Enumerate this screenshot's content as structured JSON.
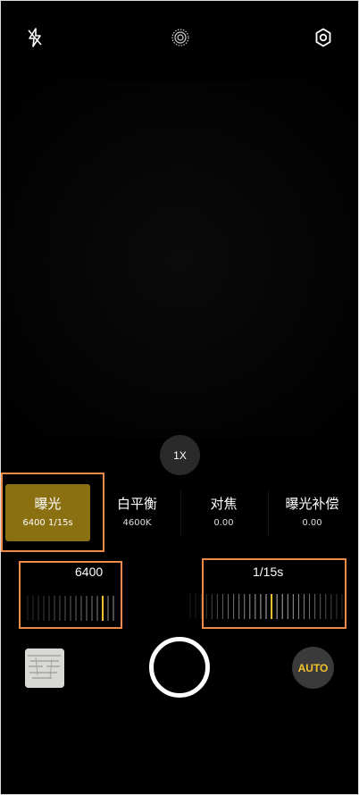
{
  "zoom": {
    "label": "1X"
  },
  "modes": [
    {
      "name": "曝光",
      "value": "6400 1/15s",
      "selected": true
    },
    {
      "name": "白平衡",
      "value": "4600K",
      "selected": false
    },
    {
      "name": "对焦",
      "value": "0.00",
      "selected": false
    },
    {
      "name": "曝光补偿",
      "value": "0.00",
      "selected": false
    }
  ],
  "iso_dial": {
    "value": "6400"
  },
  "shutter_dial": {
    "value": "1/15s"
  },
  "auto_button": {
    "label": "AUTO"
  },
  "colors": {
    "accent": "#8a7010",
    "highlight": "#f08a48",
    "auto_text": "#f4c22a",
    "slider_indicator": "#f2c432"
  },
  "icons": {
    "flash": "flash-off-icon",
    "live": "live-photo-icon",
    "settings": "settings-icon"
  }
}
